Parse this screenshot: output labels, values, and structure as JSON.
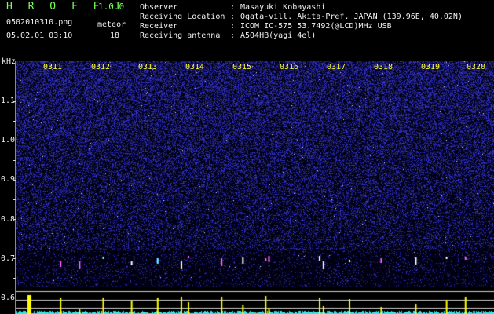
{
  "header": {
    "app_title": "H R O F F T",
    "version": "1.0.0",
    "filename": "0502010310.png",
    "meteor_label": "meteor",
    "meteor_count": "18",
    "datetime": "05.02.01 03:10"
  },
  "info": [
    {
      "key": "Observer",
      "value": "Masayuki Kobayashi"
    },
    {
      "key": "Receiving Location",
      "value": "Ogata-vill. Akita-Pref. JAPAN (139.96E, 40.02N)"
    },
    {
      "key": "Receiver",
      "value": "ICOM IC-575 53.7492(@LCD)MHz USB"
    },
    {
      "key": "Receiving antenna",
      "value": "A504HB(yagi 4el)"
    }
  ],
  "colon": ":",
  "y_axis": {
    "unit": "kHz",
    "ticks": [
      "1.1",
      "1.0",
      "0.9",
      "0.8",
      "0.7",
      "0.6"
    ]
  },
  "x_axis": {
    "ticks": [
      "0311",
      "0312",
      "0313",
      "0314",
      "0315",
      "0316",
      "0317",
      "0318",
      "0319",
      "0320"
    ]
  },
  "colors": {
    "background": "#000000",
    "header_green": "#7dff5a",
    "text_white": "#f2f2f2",
    "time_labels": "#ffff33",
    "noise_blue": "#2a2ad8",
    "level_cyan": "#33e6e6",
    "meteor_yellow": "#ffff00"
  },
  "meteor_bursts_minutes": [
    0.65,
    1.05,
    1.55,
    2.15,
    2.7,
    3.2,
    3.35,
    4.05,
    4.5,
    4.98,
    5.05,
    6.12,
    6.2,
    6.75,
    7.42,
    8.15,
    8.8,
    9.2
  ]
}
